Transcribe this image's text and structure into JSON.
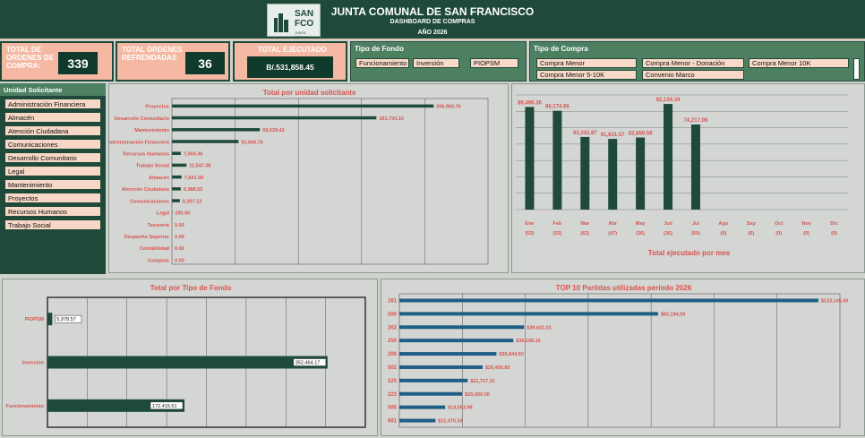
{
  "header": {
    "title": "JUNTA COMUNAL DE SAN FRANCISCO",
    "subtitle": "DASHBOARD DE COMPRAS",
    "year": "AÑO 2026",
    "logo_text_1": "SAN",
    "logo_text_2": "FCO",
    "logo_small": "JUNTA COMUNAL"
  },
  "kpis": {
    "total_ordenes_label": "TOTAL DE ORDENES DE COMPRA:",
    "total_ordenes_value": "339",
    "total_refrendadas_label": "TOTAL ORDENES REFRENDADAS",
    "total_refrendadas_value": "36",
    "total_ejecutado_label": "TOTAL EJECUTADO",
    "total_ejecutado_value": "B/.531,858.45"
  },
  "filters": {
    "tipo_fondo_title": "Tipo de Fondo",
    "tipo_fondo_items": [
      "Funcionamiento",
      "Inversión",
      "PIOPSM"
    ],
    "tipo_compra_title": "Tipo de Compra",
    "tipo_compra_items": [
      "Compra Menor",
      "Compra Menor - Donación",
      "Compra Menor 10K",
      "Compra Menor 5-10K",
      "Convenio Marco"
    ]
  },
  "unidad_solicitante": {
    "title": "Unidad Solicitante",
    "items": [
      "Administración Financiera",
      "Almacén",
      "Atención Ciudadana",
      "Comunicaciones",
      "Desarrollo Comunitario",
      "Legal",
      "Mantenimiento",
      "Proyectos",
      "Recursos Humanos",
      "Trabajo Social"
    ]
  },
  "colors": {
    "dark_green": "#1f4a3a",
    "salmon": "#f5b8a2",
    "red_label": "#d9534f",
    "blue_bar": "#1f5e85"
  },
  "chart_data": [
    {
      "type": "bar",
      "orientation": "horizontal",
      "title": "Total por unidad solicitante",
      "categories": [
        "Proyectos",
        "Desarrollo Comunitario",
        "Mantenimiento",
        "Administración Financiera",
        "Recursos Humanos",
        "Trabajo Social",
        "Almacén",
        "Atención Ciudadana",
        "Comunicaciones",
        "Legal",
        "Tesorería",
        "Despacho Superior",
        "Contabilidad",
        "Compras"
      ],
      "values": [
        206960.76,
        161734.1,
        69539.42,
        52660.76,
        7004.36,
        11547.38,
        7641.0,
        6988.55,
        6307.12,
        285.0,
        0,
        0,
        0,
        0
      ],
      "labels": [
        "206,960.76",
        "161,734.10",
        "69,539.42",
        "52,660.76",
        "7,004.36",
        "11,547.38",
        "7,641.00",
        "6,988.55",
        "6,307.12",
        "285.00",
        "0.00",
        "0.00",
        "0.00",
        "0.00"
      ],
      "xlim": [
        0,
        250000
      ]
    },
    {
      "type": "bar",
      "title": "Total ejecutado por mes",
      "categories": [
        "Ene",
        "Feb",
        "Mar",
        "Abr",
        "May",
        "Jun",
        "Jul",
        "Ago",
        "Sep",
        "Oct",
        "Nov",
        "Dic"
      ],
      "counts": [
        "(53)",
        "(53)",
        "(62)",
        "(47)",
        "(36)",
        "(36)",
        "(50)",
        "(0)",
        "(0)",
        "(0)",
        "(0)",
        "(0)"
      ],
      "values": [
        89498.36,
        86174.66,
        63342.87,
        61631.57,
        62859.59,
        92134.34,
        74217.06,
        0,
        0,
        0,
        0,
        0
      ],
      "labels": [
        "89,498.36",
        "86,174.66",
        "63,342.87",
        "61,631.57",
        "62,859.59",
        "92,134.34",
        "74,217.06",
        "",
        "",
        "",
        "",
        ""
      ],
      "ylim": [
        0,
        100000
      ]
    },
    {
      "type": "bar",
      "orientation": "horizontal",
      "title": "Total por Tipo de Fondo",
      "categories": [
        "PIOPSM",
        "Inversión",
        "Funcionamiento"
      ],
      "values": [
        5978.57,
        352464.17,
        172415.61
      ],
      "labels": [
        "5,978.57",
        "352,464.17",
        "172,415.61"
      ],
      "xlim": [
        0,
        400000
      ]
    },
    {
      "type": "bar",
      "orientation": "horizontal",
      "title": "TOP 10 Partidas utilizadas período 2026",
      "categories": [
        "261",
        "580",
        "262",
        "250",
        "200",
        "502",
        "525",
        "223",
        "565",
        "661"
      ],
      "values": [
        133145.6,
        82194.09,
        39641.01,
        36198.16,
        30844.6,
        26450.85,
        21717.31,
        20000.0,
        14563.96,
        11470.34
      ],
      "labels": [
        "$133,145.60",
        "$82,194.09",
        "$39,641.01",
        "$36,198.16",
        "$30,844.60",
        "$26,450.85",
        "$21,717.31",
        "$20,000.00",
        "$14,563.96",
        "$11,470.34"
      ],
      "xlim": [
        0,
        140000
      ]
    }
  ]
}
